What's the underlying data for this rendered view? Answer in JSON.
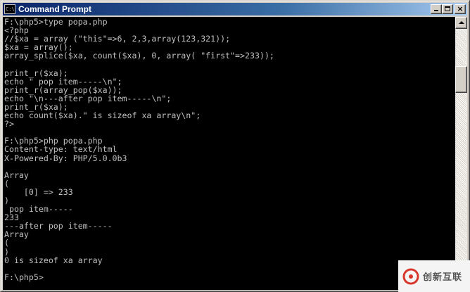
{
  "window": {
    "title": "Command Prompt",
    "icon": "console-icon",
    "icon_glyph": "C:\\",
    "controls": {
      "minimize": "minimize-icon",
      "maximize": "maximize-icon",
      "close": "close-icon",
      "close_glyph": "×"
    }
  },
  "console": {
    "text": "F:\\php5>type popa.php\n<?php\n//$xa = array (\"this\"=>6, 2,3,array(123,321));\n$xa = array();\narray_splice($xa, count($xa), 0, array( \"first\"=>233));\n\nprint_r($xa);\necho \" pop item-----\\n\";\nprint_r(array_pop($xa));\necho \"\\n---after pop item-----\\n\";\nprint_r($xa);\necho count($xa).\" is sizeof xa array\\n\";\n?>\n\nF:\\php5>php popa.php\nContent-type: text/html\nX-Powered-By: PHP/5.0.0b3\n\nArray\n(\n    [0] => 233\n)\n pop item-----\n233\n---after pop item-----\nArray\n(\n)\n0 is sizeof xa array\n\nF:\\php5>",
    "colors": {
      "background": "#000000",
      "foreground": "#c0c0c0"
    }
  },
  "scrollbar": {
    "up": "scroll-up-arrow-icon",
    "down": "scroll-down-arrow-icon"
  },
  "watermark": {
    "text": "创新互联",
    "logo": "brand-logo-icon"
  }
}
